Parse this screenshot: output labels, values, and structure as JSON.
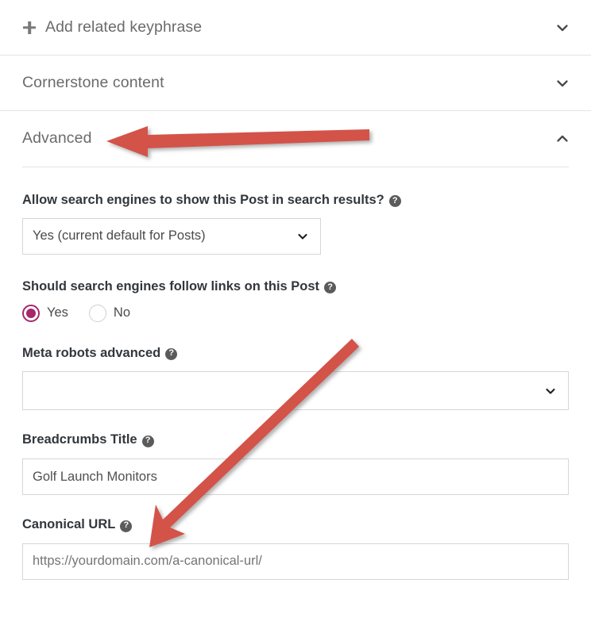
{
  "panel": {
    "accordion": [
      {
        "label": "Add related keyphrase",
        "icon": "plus-icon",
        "chevron": "chevron-down-icon",
        "expanded": false
      },
      {
        "label": "Cornerstone content",
        "chevron": "chevron-down-icon",
        "expanded": false
      },
      {
        "label": "Advanced",
        "chevron": "chevron-up-icon",
        "expanded": true
      }
    ]
  },
  "advanced": {
    "allow_indexing": {
      "label": "Allow search engines to show this Post in search results?",
      "help_icon": "help-icon",
      "help_glyph": "?",
      "selected": "Yes (current default for Posts)",
      "caret_icon": "chevron-down-icon"
    },
    "follow_links": {
      "label": "Should search engines follow links on this Post",
      "help_icon": "help-icon",
      "help_glyph": "?",
      "options": [
        {
          "label": "Yes",
          "checked": true
        },
        {
          "label": "No",
          "checked": false
        }
      ]
    },
    "meta_robots_advanced": {
      "label": "Meta robots advanced",
      "help_icon": "help-icon",
      "help_glyph": "?",
      "selected": "",
      "caret_icon": "chevron-down-icon"
    },
    "breadcrumbs_title": {
      "label": "Breadcrumbs Title",
      "help_icon": "help-icon",
      "help_glyph": "?",
      "value": "Golf Launch Monitors",
      "placeholder": ""
    },
    "canonical_url": {
      "label": "Canonical URL",
      "help_icon": "help-icon",
      "help_glyph": "?",
      "value": "",
      "placeholder": "https://yourdomain.com/a-canonical-url/"
    }
  },
  "annotations": {
    "arrow_color": "#d35348",
    "arrows": [
      {
        "name": "arrow-pointing-advanced",
        "direction": "left",
        "target": "Advanced"
      },
      {
        "name": "arrow-pointing-canonical-url",
        "direction": "down-left",
        "target": "Canonical URL"
      }
    ]
  },
  "colors": {
    "accent": "#a4286a",
    "border": "#d6d6d6",
    "divider": "#e2e4e7",
    "label": "#32373c",
    "muted_text": "#6b6b6b"
  }
}
